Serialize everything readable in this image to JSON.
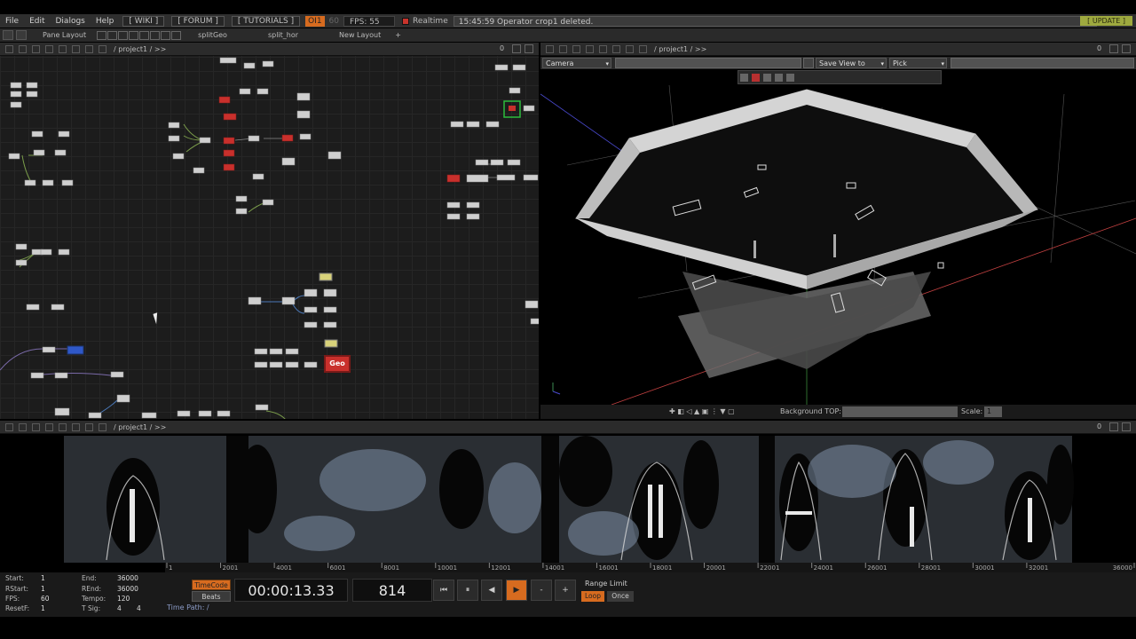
{
  "menubar": {
    "items": [
      "File",
      "Edit",
      "Dialogs",
      "Help"
    ],
    "links": [
      "[ WIKI ]",
      "[ FORUM ]",
      "[ TUTORIALS ]"
    ],
    "oi_badge": "OI1",
    "fps_max": "60",
    "fps": "FPS: 55",
    "realtime": "Realtime",
    "status": "15:45:59 Operator crop1 deleted.",
    "update": "[ UPDATE ]"
  },
  "panebar": {
    "pane_layout": "Pane Layout",
    "tabs": [
      "splitGeo",
      "split_hor",
      "New Layout"
    ],
    "add": "+"
  },
  "network": {
    "path": "/ project1 / >>",
    "zoom": "0",
    "geo_label": "Geo"
  },
  "viewer": {
    "path": "/ project1 / >>",
    "zoom": "0",
    "camera": "Camera",
    "save_view": "Save View to",
    "pick": "Pick",
    "background_top": "Background TOP:",
    "scale_label": "Scale:",
    "scale_value": "1"
  },
  "texture": {
    "path": "/ project1 / >>",
    "zoom": "0"
  },
  "timeline": {
    "ticks": [
      "1",
      "2001",
      "4001",
      "6001",
      "8001",
      "10001",
      "12001",
      "14001",
      "16001",
      "18001",
      "20001",
      "22001",
      "24001",
      "26001",
      "28001",
      "30001",
      "32001",
      "36000"
    ]
  },
  "range": {
    "start_label": "Start:",
    "start": "1",
    "end_label": "End:",
    "end": "36000",
    "rstart_label": "RStart:",
    "rstart": "1",
    "rend_label": "REnd:",
    "rend": "36000",
    "fps_label": "FPS:",
    "fps": "60",
    "tempo_label": "Tempo:",
    "tempo": "120",
    "reset_label": "ResetF:",
    "reset": "1",
    "tsig_label": "T Sig:",
    "tsig_a": "4",
    "tsig_b": "4"
  },
  "transport": {
    "timecode_btn": "TimeCode",
    "beats_btn": "Beats",
    "timecode": "00:00:13.33",
    "frame": "814",
    "buttons": [
      "⏮",
      "⏸",
      "◀",
      "▶",
      "-",
      "+"
    ],
    "range_limit": "Range Limit",
    "loop": "Loop",
    "once": "Once",
    "time_path": "Time Path: /"
  },
  "colors": {
    "accent_orange": "#d76b1f",
    "update_green": "#9ea93f",
    "geo_red": "#c9302c",
    "timeline_blue": "#2f5f9f"
  }
}
